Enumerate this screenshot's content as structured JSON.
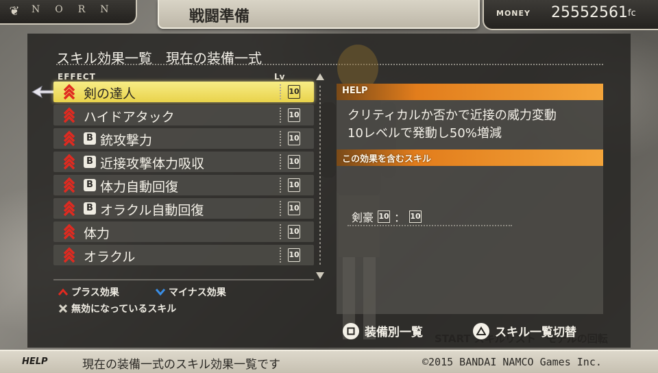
{
  "topbar": {
    "logo_text": "NORN",
    "screen_title": "戦闘準備",
    "money_label": "MONEY",
    "money_value": "25552561",
    "money_unit": "fc"
  },
  "panel": {
    "heading": "スキル効果一覧　現在の装備一式",
    "col_effect": "EFFECT",
    "col_lv": "Lv"
  },
  "skills": [
    {
      "name": "剣の達人",
      "b": false,
      "lv": "10",
      "selected": true
    },
    {
      "name": "ハイドアタック",
      "b": false,
      "lv": "10",
      "selected": false
    },
    {
      "name": "銃攻撃力",
      "b": true,
      "lv": "10",
      "selected": false
    },
    {
      "name": "近接攻撃体力吸収",
      "b": true,
      "lv": "10",
      "selected": false
    },
    {
      "name": "体力自動回復",
      "b": true,
      "lv": "10",
      "selected": false
    },
    {
      "name": "オラクル自動回復",
      "b": true,
      "lv": "10",
      "selected": false
    },
    {
      "name": "体力",
      "b": false,
      "lv": "10",
      "selected": false
    },
    {
      "name": "オラクル",
      "b": false,
      "lv": "10",
      "selected": false
    }
  ],
  "badge_b": "B",
  "legend": {
    "plus": "プラス効果",
    "minus": "マイナス効果",
    "disabled": "無効になっているスキル"
  },
  "help": {
    "title": "HELP",
    "line1": "クリティカルか否かで近接の威力変動",
    "line2": "10レベルで発動し50%増減",
    "related_title": "この効果を含むスキル",
    "related_name": "剣豪",
    "related_lv1": "10",
    "related_sep": "：",
    "related_lv2": "10"
  },
  "buttons": {
    "square_label": "装備別一覧",
    "triangle_label": "スキル一覧切替",
    "ghost": "START スキルリスト　モデルの回転"
  },
  "footer": {
    "help_label": "HELP",
    "help_text": "現在の装備一式のスキル効果一覧です",
    "copyright": "©2015 BANDAI NAMCO Games Inc."
  },
  "colors": {
    "selected_row": "#f0dd5c",
    "plus_chevron": "#e02a20",
    "minus_chevron": "#3a8ee6",
    "help_bar": "#f3a43a"
  }
}
